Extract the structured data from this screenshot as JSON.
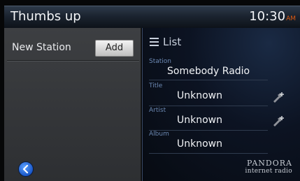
{
  "header": {
    "title": "Thumbs up",
    "time": "10:30",
    "ampm": "AM"
  },
  "left_panel": {
    "new_station_label": "New Station",
    "add_label": "Add",
    "back_icon": "chevron-left-icon"
  },
  "right_panel": {
    "list_label": "List",
    "fields": [
      {
        "label": "Station",
        "value": "Somebody Radio"
      },
      {
        "label": "Title",
        "value": "Unknown"
      },
      {
        "label": "Artist",
        "value": "Unknown"
      },
      {
        "label": "Album",
        "value": "Unknown"
      }
    ],
    "brand_line1": "PANDORA",
    "brand_line2": "internet radio"
  },
  "colors": {
    "accent_ampm": "#e05a10",
    "back_button": "#1a57c8"
  }
}
